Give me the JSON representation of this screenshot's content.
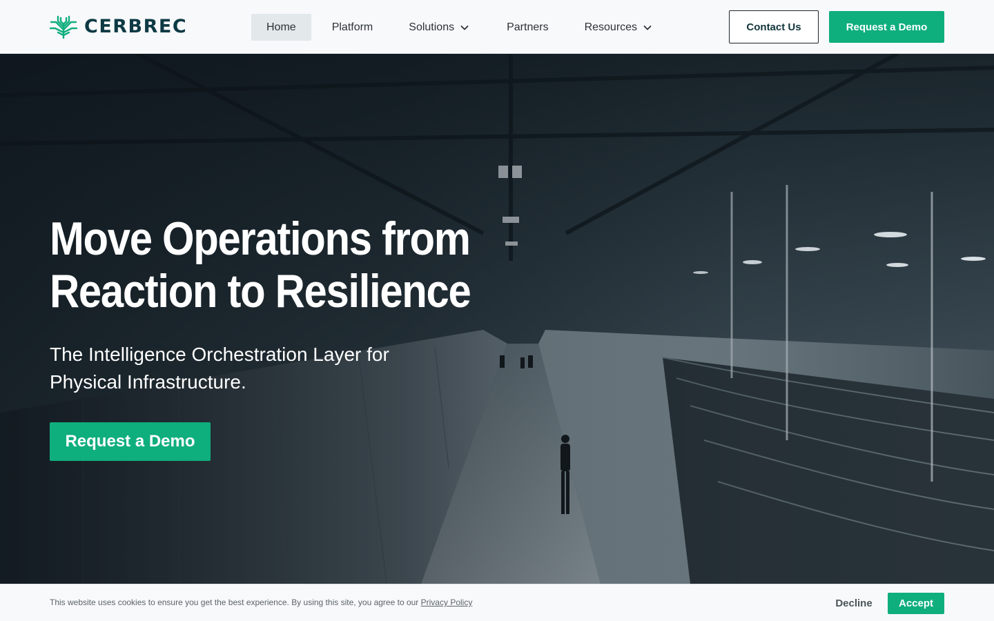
{
  "brand": {
    "name": "CERBREC",
    "logo_icon": "circuit-tree-icon",
    "logo_color": "#0fae7d",
    "text_color": "#0d3a44"
  },
  "nav": {
    "items": [
      {
        "label": "Home",
        "active": true
      },
      {
        "label": "Platform"
      },
      {
        "label": "Solutions",
        "icon": "chevron-down-icon"
      },
      {
        "label": "Partners"
      },
      {
        "label": "Resources",
        "icon": "chevron-down-icon"
      }
    ]
  },
  "header": {
    "contact_label": "Contact Us",
    "demo_label": "Request a Demo"
  },
  "hero": {
    "title_line1": "Move Operations from",
    "title_line2": "Reaction to Resilience",
    "subtitle_line1": "The Intelligence Orchestration Layer for",
    "subtitle_line2": "Physical Infrastructure.",
    "cta_label": "Request a Demo",
    "background": "data-center-warehouse-photo"
  },
  "cookie": {
    "message": "This website uses cookies to ensure you get the best experience. By using this site, you agree to our ",
    "link_label": "Privacy Policy",
    "decline_label": "Decline",
    "accept_label": "Accept"
  },
  "colors": {
    "accent": "#0fae7d",
    "header_bg": "#f8f9fa",
    "active_nav_bg": "#e3e8eb"
  }
}
